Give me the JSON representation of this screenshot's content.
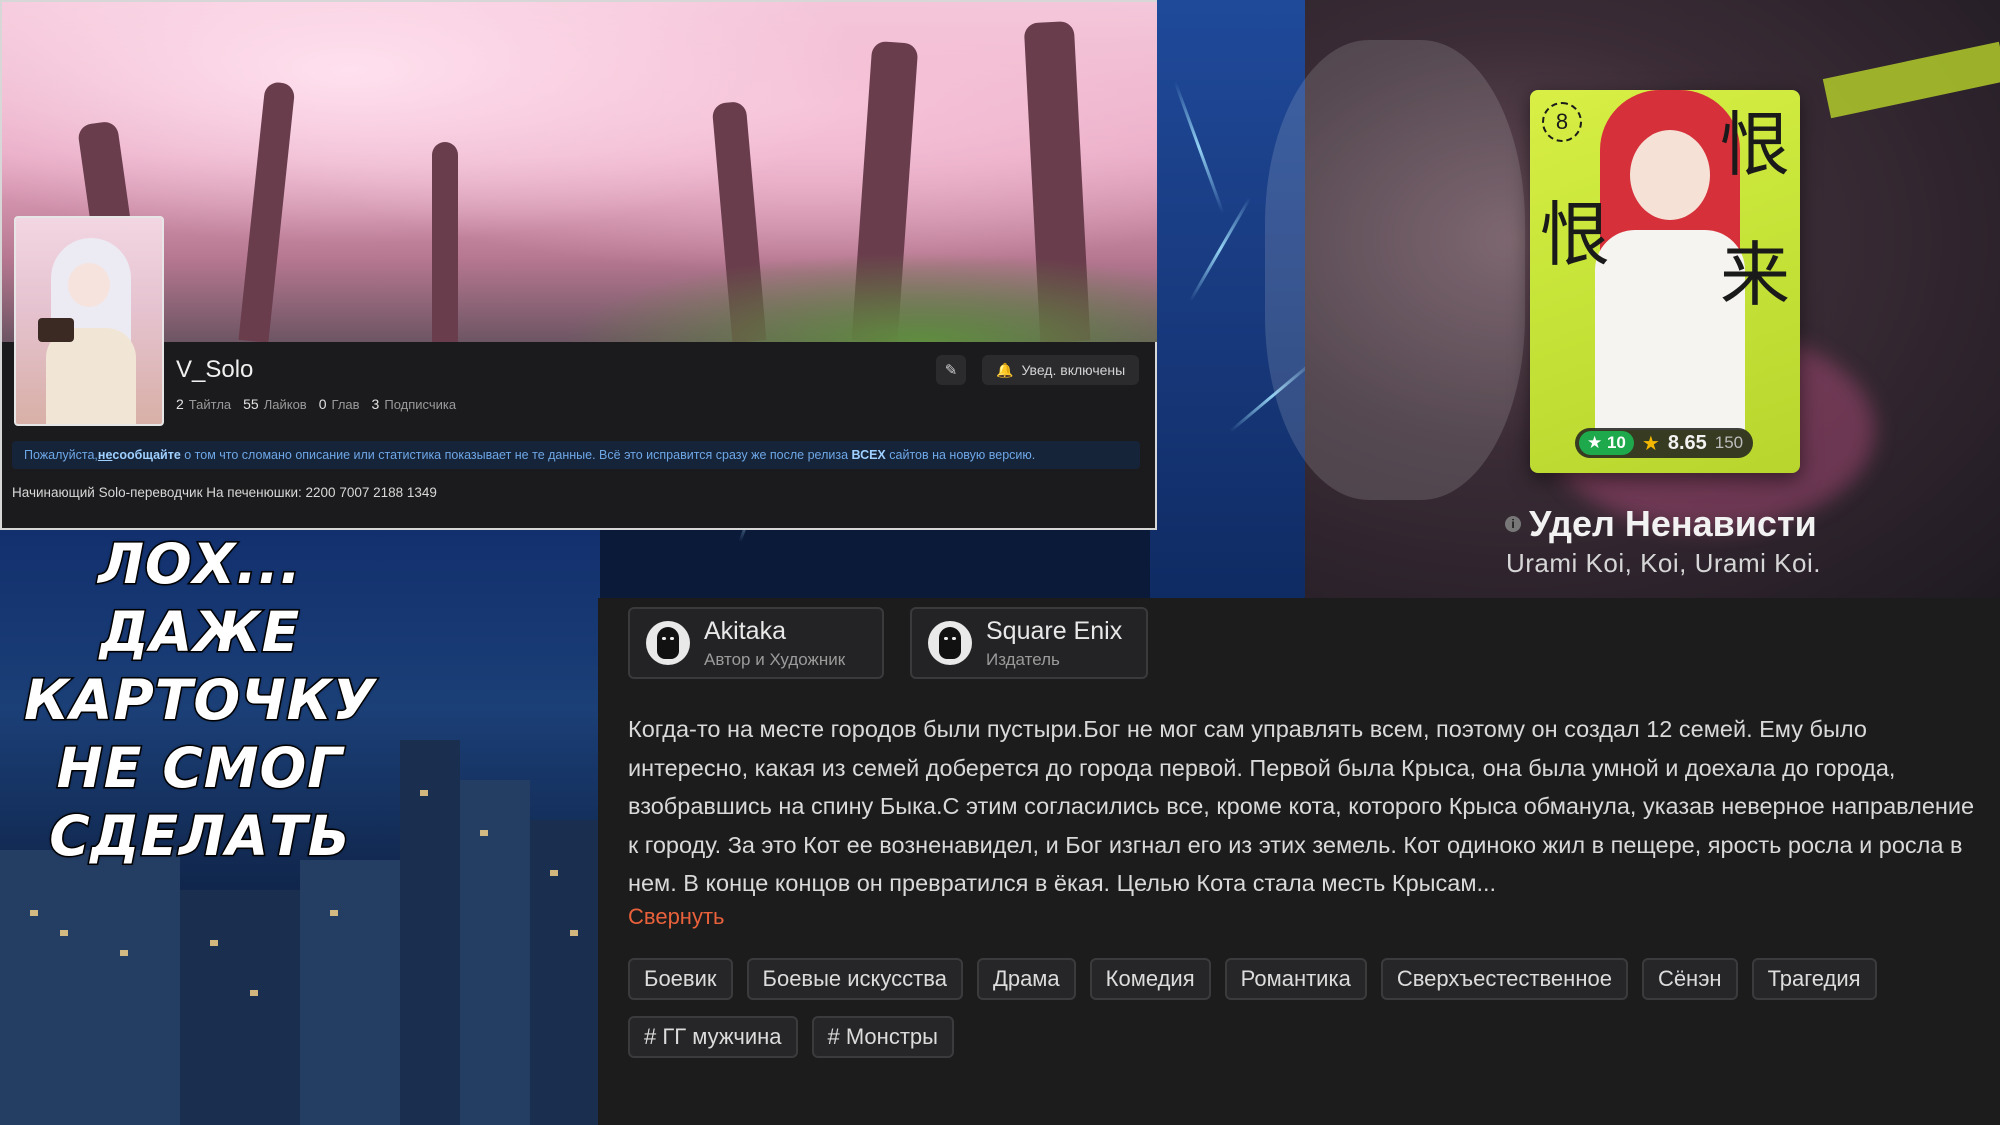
{
  "profile": {
    "username": "V_Solo",
    "stats": [
      {
        "value": "2",
        "label": "Тайтла"
      },
      {
        "value": "55",
        "label": "Лайков"
      },
      {
        "value": "0",
        "label": "Глав"
      },
      {
        "value": "3",
        "label": "Подписчика"
      }
    ],
    "edit_icon": "pencil-icon",
    "notify_label": "Увед. включены",
    "notify_icon": "bell-icon",
    "notice": {
      "part1": "Пожалуйста, ",
      "ne": "не",
      "soobsh": " сообщайте",
      "part2": " о том что сломано описание или статистика показывает не те данные. Всё это исправится сразу же после релиза ",
      "vseh": "ВСЕХ",
      "part3": " сайтов на новую версию."
    },
    "bio": "Начинающий Solo-переводчик На печенюшки: 2200 7007 2188 1349"
  },
  "meme": {
    "lines": [
      "ЛОХ...",
      "ДАЖЕ",
      "КАРТОЧКУ",
      "НЕ СМОГ",
      "СДЕЛАТЬ"
    ]
  },
  "manga": {
    "cover_volume": "8",
    "my_rating": "10",
    "avg_rating": "8.65",
    "rating_count": "150",
    "title": "Удел Ненависти",
    "alt_names": "Urami Koi, Koi, Urami Koi.",
    "creators": [
      {
        "name": "Akitaka",
        "role": "Автор и Художник"
      },
      {
        "name": "Square Enix",
        "role": "Издатель"
      }
    ],
    "description": "Когда-то на месте городов были пустыри.Бог не мог сам управлять всем, поэтому он создал 12 семей. Ему было интересно, какая из семей доберется до города первой. Первой была Крыса, она была умной и доехала до города, взобравшись на спину Быка.С этим согласились все, кроме кота, которого Крыса обманула, указав неверное направление к городу. За это Кот ее возненавидел, и Бог изгнал его из этих земель. Кот одиноко жил в пещере, ярость росла и росла в нем. В конце концов он превратился в ёкая. Целью Кота стала месть Крысам...",
    "collapse_label": "Свернуть",
    "genres": [
      "Боевик",
      "Боевые искусства",
      "Драма",
      "Комедия",
      "Романтика",
      "Сверхъестественное",
      "Сёнэн",
      "Трагедия"
    ],
    "tags": [
      "# ГГ мужчина",
      "# Монстры"
    ]
  },
  "colors": {
    "accent_orange": "#e8613a",
    "rating_green": "#1eaa4c",
    "star_gold": "#f5b800",
    "notice_blue": "#6ea7e6"
  }
}
